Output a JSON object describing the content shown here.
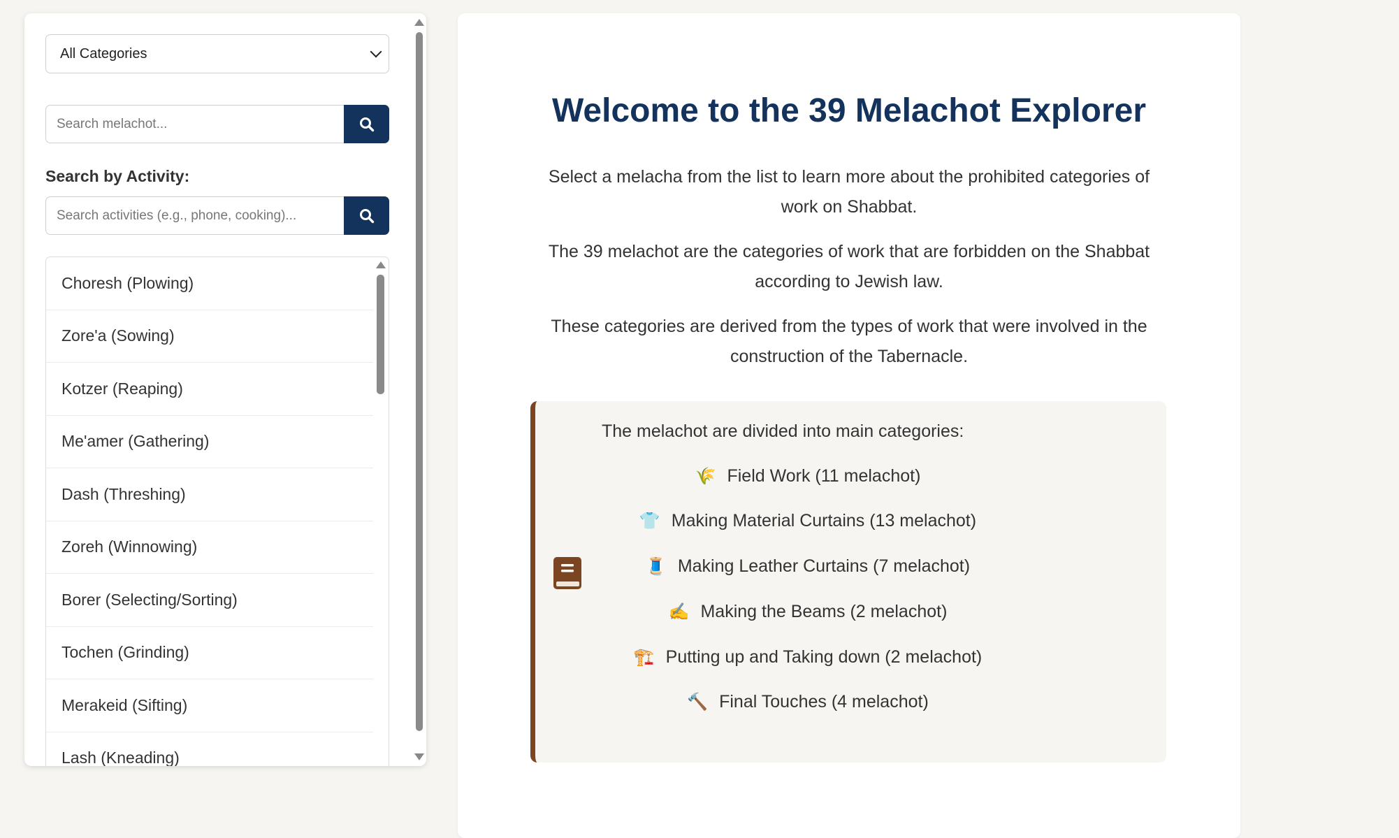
{
  "sidebar": {
    "category_select": {
      "value": "All Categories"
    },
    "search": {
      "placeholder": "Search melachot..."
    },
    "activity": {
      "label": "Search by Activity:",
      "placeholder": "Search activities (e.g., phone, cooking)..."
    },
    "melachot": [
      "Choresh (Plowing)",
      "Zore'a (Sowing)",
      "Kotzer (Reaping)",
      "Me'amer (Gathering)",
      "Dash (Threshing)",
      "Zoreh (Winnowing)",
      "Borer (Selecting/Sorting)",
      "Tochen (Grinding)",
      "Merakeid (Sifting)",
      "Lash (Kneading)"
    ]
  },
  "main": {
    "title": "Welcome to the 39 Melachot Explorer",
    "paragraphs": [
      "Select a melacha from the list to learn more about the prohibited categories of work on Shabbat.",
      "The 39 melachot are the categories of work that are forbidden on the Shabbat according to Jewish law.",
      "These categories are derived from the types of work that were involved in the construction of the Tabernacle."
    ],
    "categories_heading": "The melachot are divided into main categories:",
    "categories": [
      {
        "emoji": "🌾",
        "icon": "wheat-icon",
        "label": "Field Work (11 melachot)"
      },
      {
        "emoji": "👕",
        "icon": "shirt-icon",
        "label": "Making Material Curtains (13 melachot)"
      },
      {
        "emoji": "🧵",
        "icon": "thread-icon",
        "label": "Making Leather Curtains (7 melachot)"
      },
      {
        "emoji": "✍️",
        "icon": "writing-hand-icon",
        "label": "Making the Beams (2 melachot)"
      },
      {
        "emoji": "🏗️",
        "icon": "construction-icon",
        "label": "Putting up and Taking down (2 melachot)"
      },
      {
        "emoji": "🔨",
        "icon": "hammer-icon",
        "label": "Final Touches (4 melachot)"
      }
    ]
  },
  "colors": {
    "accent": "#13325c",
    "box_border": "#7a4520",
    "background": "#f6f5f1"
  }
}
